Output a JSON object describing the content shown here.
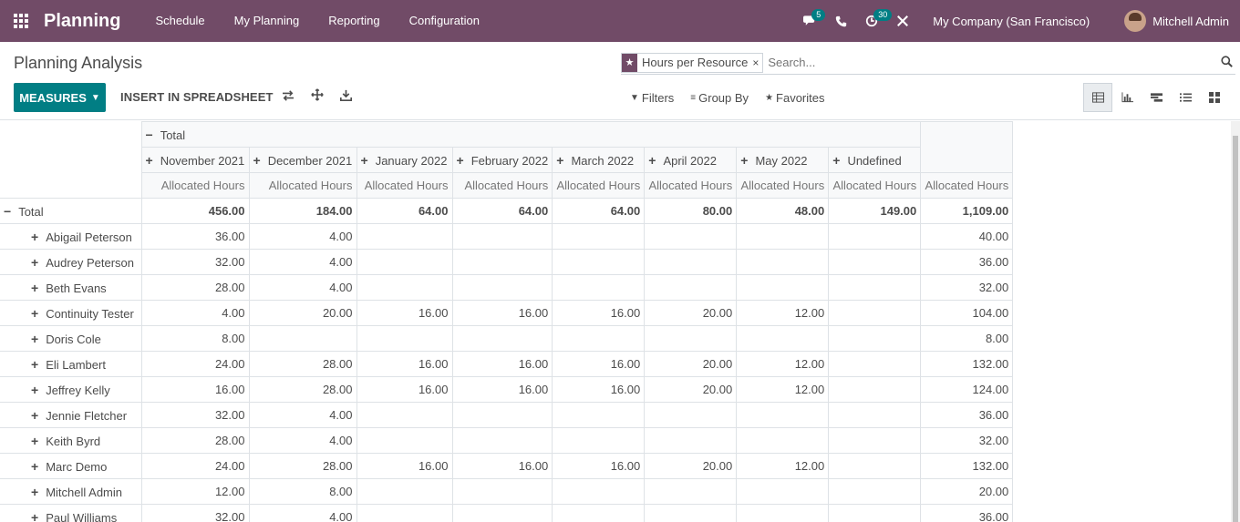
{
  "navbar": {
    "app_name": "Planning",
    "menu": [
      "Schedule",
      "My Planning",
      "Reporting",
      "Configuration"
    ],
    "messages_badge": "5",
    "activity_badge": "30",
    "company": "My Company (San Francisco)",
    "user": "Mitchell Admin"
  },
  "control": {
    "title": "Planning Analysis",
    "facet_label": "Hours per Resource",
    "search_placeholder": "Search...",
    "measures_label": "MEASURES",
    "insert_label": "INSERT IN SPREADSHEET",
    "filters_label": "Filters",
    "groupby_label": "Group By",
    "favorites_label": "Favorites"
  },
  "pivot": {
    "col_total_label": "Total",
    "columns": [
      "November 2021",
      "December 2021",
      "January 2022",
      "February 2022",
      "March 2022",
      "April 2022",
      "May 2022",
      "Undefined"
    ],
    "measure": "Allocated Hours",
    "row_total_label": "Total",
    "total_row": [
      "456.00",
      "184.00",
      "64.00",
      "64.00",
      "64.00",
      "80.00",
      "48.00",
      "149.00",
      "1,109.00"
    ],
    "rows": [
      {
        "name": "Abigail Peterson",
        "values": [
          "36.00",
          "4.00",
          "",
          "",
          "",
          "",
          "",
          "",
          "40.00"
        ]
      },
      {
        "name": "Audrey Peterson",
        "values": [
          "32.00",
          "4.00",
          "",
          "",
          "",
          "",
          "",
          "",
          "36.00"
        ]
      },
      {
        "name": "Beth Evans",
        "values": [
          "28.00",
          "4.00",
          "",
          "",
          "",
          "",
          "",
          "",
          "32.00"
        ]
      },
      {
        "name": "Continuity Tester",
        "values": [
          "4.00",
          "20.00",
          "16.00",
          "16.00",
          "16.00",
          "20.00",
          "12.00",
          "",
          "104.00"
        ]
      },
      {
        "name": "Doris Cole",
        "values": [
          "8.00",
          "",
          "",
          "",
          "",
          "",
          "",
          "",
          "8.00"
        ]
      },
      {
        "name": "Eli Lambert",
        "values": [
          "24.00",
          "28.00",
          "16.00",
          "16.00",
          "16.00",
          "20.00",
          "12.00",
          "",
          "132.00"
        ]
      },
      {
        "name": "Jeffrey Kelly",
        "values": [
          "16.00",
          "28.00",
          "16.00",
          "16.00",
          "16.00",
          "20.00",
          "12.00",
          "",
          "124.00"
        ]
      },
      {
        "name": "Jennie Fletcher",
        "values": [
          "32.00",
          "4.00",
          "",
          "",
          "",
          "",
          "",
          "",
          "36.00"
        ]
      },
      {
        "name": "Keith Byrd",
        "values": [
          "28.00",
          "4.00",
          "",
          "",
          "",
          "",
          "",
          "",
          "32.00"
        ]
      },
      {
        "name": "Marc Demo",
        "values": [
          "24.00",
          "28.00",
          "16.00",
          "16.00",
          "16.00",
          "20.00",
          "12.00",
          "",
          "132.00"
        ]
      },
      {
        "name": "Mitchell Admin",
        "values": [
          "12.00",
          "8.00",
          "",
          "",
          "",
          "",
          "",
          "",
          "20.00"
        ]
      },
      {
        "name": "Paul Williams",
        "values": [
          "32.00",
          "4.00",
          "",
          "",
          "",
          "",
          "",
          "",
          "36.00"
        ]
      }
    ]
  }
}
